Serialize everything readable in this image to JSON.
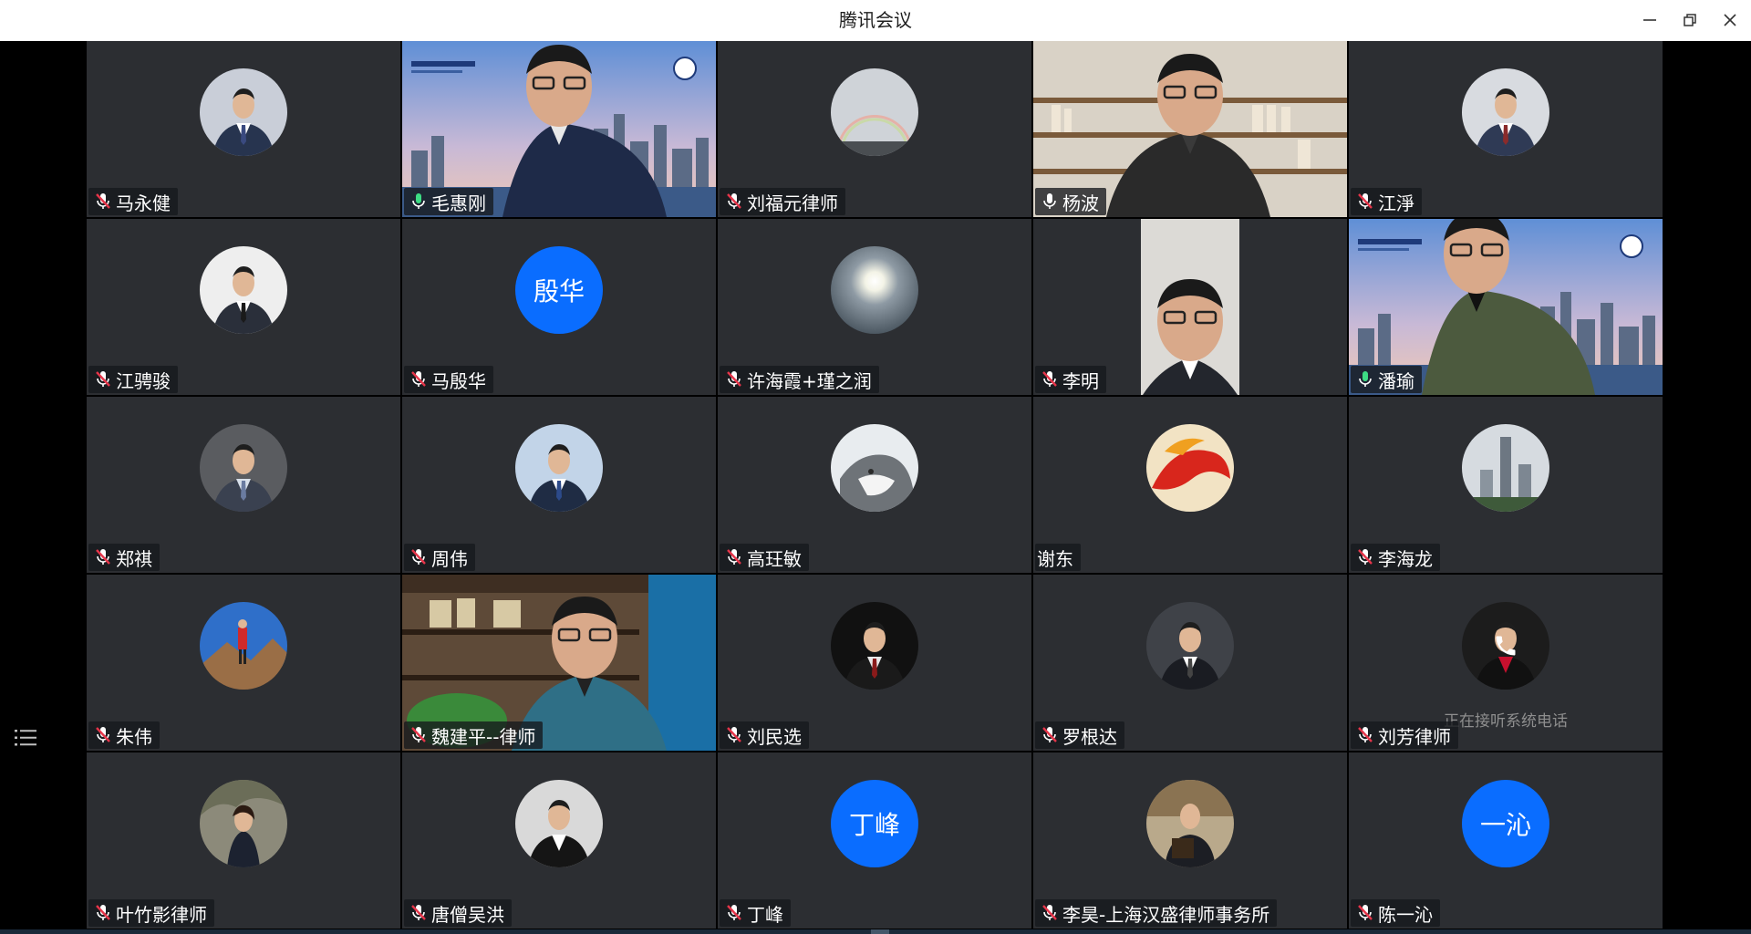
{
  "window": {
    "title": "腾讯会议"
  },
  "sidebar": {
    "list_toggle_icon": "list-icon"
  },
  "colors": {
    "accent": "#0a6dff",
    "speaking": "#3ddc84",
    "tile_bg": "#2c2e32",
    "muted": "#e6354a"
  },
  "participants": [
    {
      "name": "马永健",
      "mic": "muted",
      "avatar": "photo",
      "photo": "portrait-suit-blue"
    },
    {
      "name": "毛惠刚",
      "mic": "on",
      "avatar": "video",
      "photo": "video-city-banner"
    },
    {
      "name": "刘福元律师",
      "mic": "muted",
      "avatar": "photo",
      "photo": "rainbow-sky"
    },
    {
      "name": "杨波",
      "mic": "on-white",
      "avatar": "video",
      "photo": "video-bookshelf"
    },
    {
      "name": "江淨",
      "mic": "muted",
      "avatar": "photo",
      "photo": "portrait-suit-gray"
    },
    {
      "name": "江骋骏",
      "mic": "muted",
      "avatar": "photo",
      "photo": "portrait-suit-white"
    },
    {
      "name": "马殷华",
      "mic": "muted",
      "avatar": "text",
      "initials": "殷华"
    },
    {
      "name": "许海霞+瑾之润",
      "mic": "muted",
      "avatar": "photo",
      "photo": "sun-sky"
    },
    {
      "name": "李明",
      "mic": "muted",
      "avatar": "video",
      "photo": "video-portrait-narrow"
    },
    {
      "name": "潘瑜",
      "mic": "on",
      "avatar": "video",
      "photo": "video-city-banner-2",
      "active": true
    },
    {
      "name": "郑祺",
      "mic": "muted",
      "avatar": "photo",
      "photo": "portrait-suit-dark"
    },
    {
      "name": "周伟",
      "mic": "muted",
      "avatar": "photo",
      "photo": "portrait-suit-blue-2"
    },
    {
      "name": "高玨敏",
      "mic": "muted",
      "avatar": "photo",
      "photo": "husky-dog"
    },
    {
      "name": "谢东",
      "mic": "none",
      "avatar": "photo",
      "photo": "red-dragon"
    },
    {
      "name": "李海龙",
      "mic": "muted",
      "avatar": "photo",
      "photo": "city-tower"
    },
    {
      "name": "朱伟",
      "mic": "muted",
      "avatar": "photo",
      "photo": "mountain-hiker"
    },
    {
      "name": "魏建平--律师",
      "mic": "muted",
      "avatar": "video",
      "photo": "video-office"
    },
    {
      "name": "刘民选",
      "mic": "muted",
      "avatar": "photo",
      "photo": "portrait-dark-bg"
    },
    {
      "name": "罗根达",
      "mic": "muted",
      "avatar": "photo",
      "photo": "portrait-suit-full"
    },
    {
      "name": "刘芳律师",
      "mic": "muted",
      "avatar": "photo",
      "photo": "portrait-woman-red",
      "status": "正在接听系统电话"
    },
    {
      "name": "叶竹影律师",
      "mic": "muted",
      "avatar": "photo",
      "photo": "woman-tree"
    },
    {
      "name": "唐僧吴洪",
      "mic": "muted",
      "avatar": "photo",
      "photo": "portrait-woman-black"
    },
    {
      "name": "丁峰",
      "mic": "muted",
      "avatar": "text",
      "initials": "丁峰"
    },
    {
      "name": "李昊-上海汉盛律师事务所",
      "mic": "muted",
      "avatar": "photo",
      "photo": "man-with-book"
    },
    {
      "name": "陈一沁",
      "mic": "muted",
      "avatar": "text",
      "initials": "一沁"
    }
  ]
}
